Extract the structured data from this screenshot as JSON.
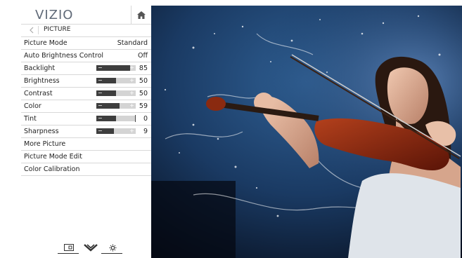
{
  "brand": "VIZIO",
  "breadcrumb": "PICTURE",
  "icons": {
    "home": "home-icon",
    "back": "back-arrow-icon",
    "input": "input-icon",
    "down": "chevron-down-icon",
    "settings": "settings-icon"
  },
  "rows": [
    {
      "label": "Picture Mode",
      "value": "Standard"
    },
    {
      "label": "Auto Brightness Control",
      "value": "Off"
    },
    {
      "label": "Backlight",
      "value": "85",
      "level": 0.85
    },
    {
      "label": "Brightness",
      "value": "50",
      "level": 0.5
    },
    {
      "label": "Contrast",
      "value": "50",
      "level": 0.5
    },
    {
      "label": "Color",
      "value": "59",
      "level": 0.59
    },
    {
      "label": "Tint",
      "value": "0",
      "level": 0.5
    },
    {
      "label": "Sharpness",
      "value": "9",
      "level": 0.45
    },
    {
      "label": "More Picture"
    },
    {
      "label": "Picture Mode Edit"
    },
    {
      "label": "Color Calibration"
    }
  ],
  "colors": {
    "menu_bg": "#ffffff",
    "slider_track": "#d4d4d4",
    "slider_fill": "#3e3e3e",
    "divider": "#d8d8d8",
    "brand": "#606a78"
  }
}
